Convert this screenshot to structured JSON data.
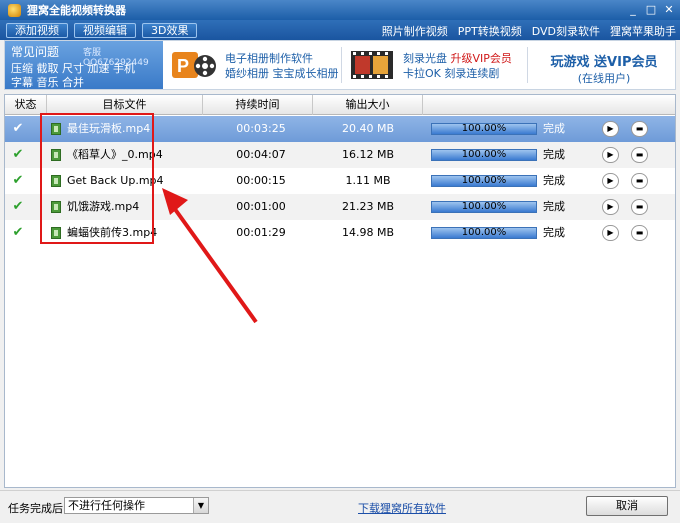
{
  "window": {
    "title": "狸窝全能视频转换器"
  },
  "toolbar": {
    "buttons": [
      "添加视频",
      "视频编辑",
      "3D效果"
    ],
    "links": [
      "照片制作视频",
      "PPT转换视频",
      "DVD刻录软件",
      "狸窝苹果助手"
    ]
  },
  "banner": {
    "faq_title": "常见问题",
    "faq_qq": "客服QQ676292449",
    "faq_links_row1": "压缩 截取 尺寸 加速 手机",
    "faq_links_row2": "字幕 音乐 合并",
    "ad1_line1": "电子相册制作软件",
    "ad1_line2": "婚纱相册 宝宝成长相册",
    "ad2_line1_a": "刻录光盘",
    "ad2_line1_b": "升级VIP会员",
    "ad2_line2": "卡拉OK 刻录连续剧",
    "ad3_line1": "玩游戏 送VIP会员",
    "ad3_line2": "(在线用户)"
  },
  "table": {
    "headers": [
      "状态",
      "目标文件",
      "持续时间",
      "输出大小"
    ],
    "rows": [
      {
        "file": "最佳玩滑板.mp4",
        "duration": "00:03:25",
        "size": "20.40 MB",
        "progress": "100.00%",
        "status": "完成"
      },
      {
        "file": "《稻草人》_0.mp4",
        "duration": "00:04:07",
        "size": "16.12 MB",
        "progress": "100.00%",
        "status": "完成"
      },
      {
        "file": "Get Back Up.mp4",
        "duration": "00:00:15",
        "size": "1.11 MB",
        "progress": "100.00%",
        "status": "完成"
      },
      {
        "file": "饥饿游戏.mp4",
        "duration": "00:01:00",
        "size": "21.23 MB",
        "progress": "100.00%",
        "status": "完成"
      },
      {
        "file": "蝙蝠侠前传3.mp4",
        "duration": "00:01:29",
        "size": "14.98 MB",
        "progress": "100.00%",
        "status": "完成"
      }
    ]
  },
  "bottom": {
    "task_label": "任务完成后:",
    "task_select": "不进行任何操作",
    "download_link": "下载狸窝所有软件",
    "cancel": "取消"
  }
}
